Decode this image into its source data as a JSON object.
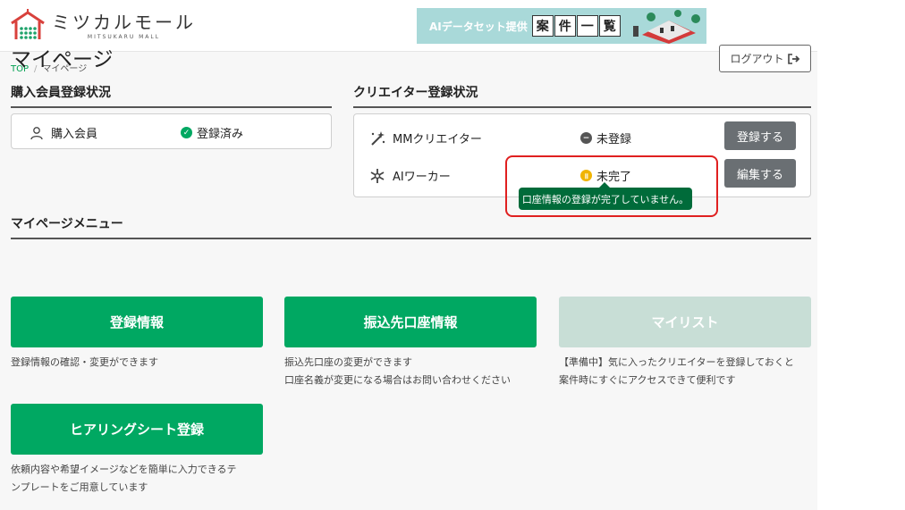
{
  "header": {
    "logo_title": "ミツカルモール",
    "logo_sub": "MITSUKARU MALL",
    "banner_text": "AIデータセット提供",
    "banner_boxes": [
      "案",
      "件",
      "一",
      "覧"
    ]
  },
  "breadcrumb": {
    "home": "TOP",
    "separator": "/",
    "current": "マイページ"
  },
  "page_title": "マイページ",
  "logout_label": "ログアウト",
  "buyer": {
    "section_title": "購入会員登録状況",
    "label": "購入会員",
    "status": "登録済み"
  },
  "creator": {
    "section_title": "クリエイター登録状況",
    "rows": [
      {
        "label": "MMクリエイター",
        "status": "未登録",
        "button": "登録する"
      },
      {
        "label": "AIワーカー",
        "status": "未完了",
        "button": "編集する"
      }
    ],
    "tooltip": "口座情報の登録が完了していません。"
  },
  "menu": {
    "section_title": "マイページメニュー",
    "items": [
      {
        "label": "登録情報",
        "desc1": "登録情報の確認・変更ができます",
        "desc2": ""
      },
      {
        "label": "振込先口座情報",
        "desc1": "振込先口座の変更ができます",
        "desc2": "口座名義が変更になる場合はお問い合わせください"
      },
      {
        "label": "マイリスト",
        "desc1": "【準備中】気に入ったクリエイターを登録しておくと",
        "desc2": "案件時にすぐにアクセスできて便利です"
      },
      {
        "label": "ヒアリングシート登録",
        "desc1": "依頼内容や希望イメージなどを簡単に入力できるテ",
        "desc2": "ンプレートをご用意しています"
      }
    ]
  },
  "colors": {
    "green": "#00a862",
    "disabled": "#c8ded6",
    "gray_button": "#6a6f73",
    "tooltip": "#006b3a",
    "warning": "#f0b400",
    "highlight": "#e02020"
  }
}
